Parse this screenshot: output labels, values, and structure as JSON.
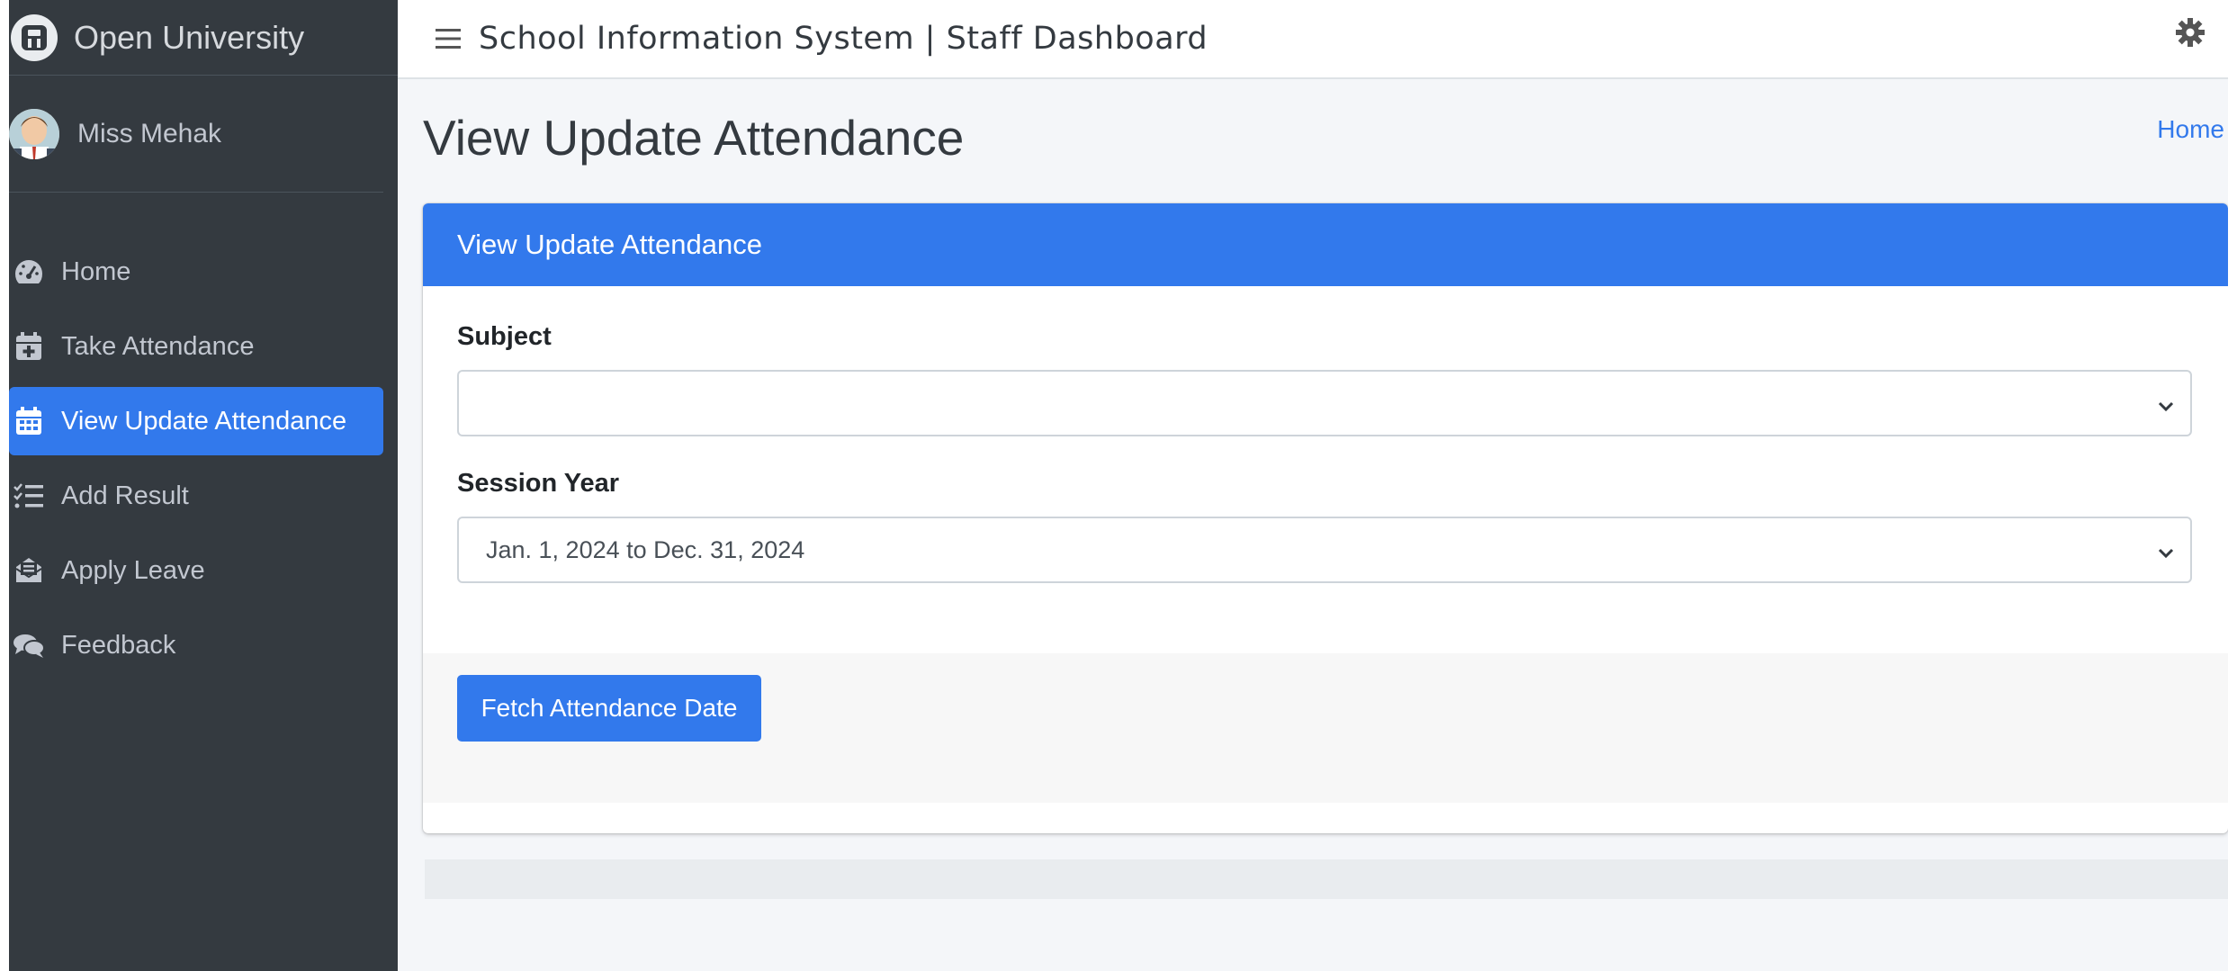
{
  "brand": {
    "name": "Open University",
    "logo_icon": "brand-logo-icon"
  },
  "user": {
    "name": "Miss Mehak",
    "avatar_icon": "user-avatar"
  },
  "sidebar": {
    "items": [
      {
        "label": "Home",
        "icon": "tachometer-icon",
        "active": false
      },
      {
        "label": "Take Attendance",
        "icon": "calendar-plus-icon",
        "active": false
      },
      {
        "label": "View Update Attendance",
        "icon": "calendar-icon",
        "active": true
      },
      {
        "label": "Add Result",
        "icon": "tasks-icon",
        "active": false
      },
      {
        "label": "Apply Leave",
        "icon": "envelope-open-icon",
        "active": false
      },
      {
        "label": "Feedback",
        "icon": "comments-icon",
        "active": false
      }
    ]
  },
  "topbar": {
    "title": "School Information System | Staff Dashboard"
  },
  "page": {
    "title": "View Update Attendance",
    "breadcrumb": "Home"
  },
  "card": {
    "header": "View Update Attendance",
    "subject_label": "Subject",
    "subject_value": "",
    "session_label": "Session Year",
    "session_value": "Jan. 1, 2024 to Dec. 31, 2024",
    "fetch_button": "Fetch Attendance Date"
  },
  "colors": {
    "sidebar_bg": "#343a40",
    "primary": "#3279ec",
    "content_bg": "#f4f6f9"
  }
}
